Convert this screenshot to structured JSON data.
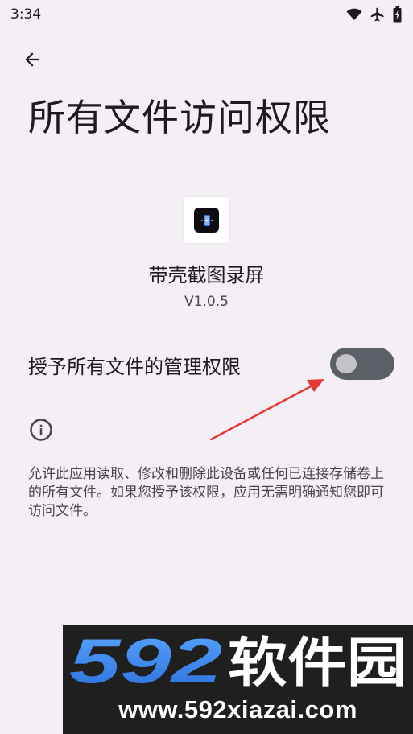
{
  "status_bar": {
    "time": "3:34",
    "icons": [
      "wifi-icon",
      "airplane-icon",
      "battery-icon"
    ]
  },
  "header": {
    "back_icon": "arrow-left-icon",
    "title": "所有文件访问权限"
  },
  "app": {
    "name": "带壳截图录屏",
    "version": "V1.0.5"
  },
  "permission": {
    "label": "授予所有文件的管理权限",
    "enabled": false
  },
  "info": {
    "icon": "info-icon",
    "description": "允许此应用读取、修改和删除此设备或任何已连接存储卷上的所有文件。如果您授予该权限，应用无需明确通知您即可访问文件。"
  },
  "watermark": {
    "logo_digits": "592",
    "logo_text": "软件园",
    "url": "www.592xiazai.com"
  },
  "colors": {
    "background": "#f4eff4",
    "toggle_track": "#5d5f66",
    "annotation_arrow": "#e53935",
    "watermark_blue": "#3b8cf0"
  }
}
